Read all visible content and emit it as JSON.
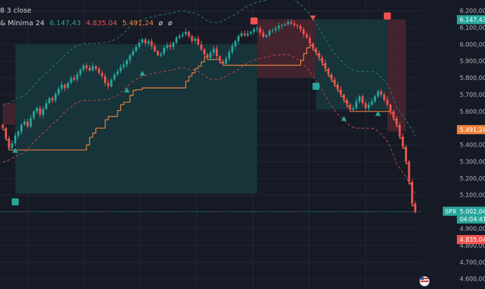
{
  "legend": {
    "line1": "8 3 close",
    "line2_prefix": "& Mínima 24",
    "v1": "6.147,43",
    "v2": "4.835,04",
    "v3": "5.491,24",
    "v4": "ø",
    "v5": "ø"
  },
  "price_axis": {
    "ticks": [
      "6.200,00",
      "6.100,00",
      "6.000,00",
      "5.900,00",
      "5.800,00",
      "5.700,00",
      "5.600,00",
      "5.500,00",
      "5.400,00",
      "5.300,00",
      "5.200,00",
      "5.100,00",
      "5.000,00",
      "4.900,00",
      "4.800,00",
      "4.700,00",
      "4.600,00"
    ],
    "tick_values": [
      6200,
      6100,
      6000,
      5900,
      5800,
      5700,
      5600,
      5500,
      5400,
      5300,
      5200,
      5100,
      5000,
      4900,
      4800,
      4700,
      4600
    ],
    "labels": {
      "upper": "6.147,43",
      "mid": "5.491,24",
      "symbol": "SPX",
      "last": "5.002,04",
      "countdown": "04:04:41",
      "lower": "4.835,04"
    }
  },
  "series": {
    "price_range": [
      4540,
      6265
    ],
    "close": [
      5500,
      5440,
      5380,
      5410,
      5455,
      5480,
      5520,
      5540,
      5510,
      5560,
      5600,
      5620,
      5580,
      5615,
      5650,
      5680,
      5665,
      5705,
      5735,
      5760,
      5740,
      5770,
      5800,
      5790,
      5820,
      5850,
      5875,
      5860,
      5845,
      5870,
      5855,
      5830,
      5810,
      5770,
      5750,
      5790,
      5820,
      5840,
      5865,
      5880,
      5905,
      5935,
      5960,
      5985,
      6010,
      6030,
      6005,
      6020,
      5990,
      5960,
      5935,
      5945,
      5980,
      5995,
      5985,
      6010,
      6040,
      6050,
      6060,
      6075,
      6050,
      6020,
      6035,
      6000,
      5970,
      5940,
      5920,
      5950,
      5975,
      5930,
      5900,
      5885,
      5915,
      5955,
      5990,
      6020,
      6050,
      6065,
      6055,
      6065,
      6075,
      6090,
      6095,
      6070,
      6045,
      6055,
      6080,
      6085,
      6095,
      6110,
      6115,
      6120,
      6135,
      6125,
      6115,
      6110,
      6090,
      6060,
      6040,
      6005,
      5975,
      5950,
      5920,
      5890,
      5855,
      5820,
      5790,
      5760,
      5730,
      5700,
      5670,
      5640,
      5610,
      5620,
      5660,
      5690,
      5650,
      5620,
      5640,
      5660,
      5690,
      5720,
      5700,
      5670,
      5640,
      5600,
      5560,
      5520,
      5450,
      5390,
      5300,
      5180,
      5050,
      5002
    ]
  },
  "levels": {
    "orange_stepline": "5.491,24",
    "upper_line": "6.147,43",
    "lower_line": "4.835,04"
  },
  "colors": {
    "background": "#161a25",
    "grid": "#222734",
    "up": "#26a69a",
    "down": "#ef5350",
    "orange": "#f0823c",
    "teal_zone": "#16393d",
    "red_zone": "#4a2630",
    "dashed_band": "#2a7a74",
    "dashed_band_lower": "#c0464a"
  },
  "footer": {
    "icon": "flag-icon"
  }
}
